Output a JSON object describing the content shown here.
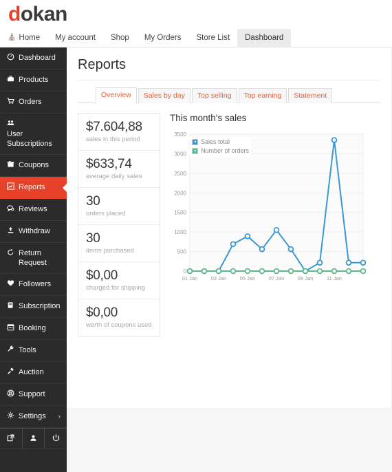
{
  "header": {
    "logo_first": "d",
    "logo_rest": "okan"
  },
  "top_nav": {
    "home_icon": "home-icon",
    "items": [
      {
        "label": "Home",
        "active": false,
        "icon": "home-icon"
      },
      {
        "label": "My account",
        "active": false
      },
      {
        "label": "Shop",
        "active": false
      },
      {
        "label": "My Orders",
        "active": false
      },
      {
        "label": "Store List",
        "active": false
      },
      {
        "label": "Dashboard",
        "active": true
      }
    ]
  },
  "sidebar": {
    "active_color": "#e8412a",
    "items": [
      {
        "label": "Dashboard",
        "icon": "dashboard-icon",
        "glyph": "⛭"
      },
      {
        "label": "Products",
        "icon": "products-icon",
        "glyph": "ὋC"
      },
      {
        "label": "Orders",
        "icon": "orders-icon",
        "glyph": "Ὥ2"
      },
      {
        "label": "User Subscriptions",
        "icon": "users-icon",
        "glyph": "὆5"
      },
      {
        "label": "Coupons",
        "icon": "coupons-icon",
        "glyph": "Ἰ1"
      },
      {
        "label": "Reports",
        "icon": "reports-icon",
        "glyph": "chart-line",
        "active": true
      },
      {
        "label": "Reviews",
        "icon": "reviews-icon",
        "glyph": "὞8"
      },
      {
        "label": "Withdraw",
        "icon": "withdraw-icon",
        "glyph": "⬆"
      },
      {
        "label": "Return Request",
        "icon": "return-icon",
        "glyph": "↺"
      },
      {
        "label": "Followers",
        "icon": "heart-icon",
        "glyph": "♥"
      },
      {
        "label": "Subscription",
        "icon": "subscription-icon",
        "glyph": "Ὅ5"
      },
      {
        "label": "Booking",
        "icon": "calendar-icon",
        "glyph": "Ὄ5"
      },
      {
        "label": "Tools",
        "icon": "wrench-icon",
        "glyph": "ὒ7"
      },
      {
        "label": "Auction",
        "icon": "gavel-icon",
        "glyph": "ὒ8"
      },
      {
        "label": "Support",
        "icon": "lifebuoy-icon",
        "glyph": "❀"
      },
      {
        "label": "Settings",
        "icon": "gear-icon",
        "glyph": "⚙",
        "chevron": "›"
      }
    ],
    "footer_buttons": [
      {
        "icon": "external-link-icon",
        "glyph": "↗"
      },
      {
        "icon": "user-icon",
        "glyph": "὆4"
      },
      {
        "icon": "power-icon",
        "glyph": "⏻"
      }
    ]
  },
  "main": {
    "title": "Reports",
    "tabs": [
      {
        "label": "Overview",
        "active": true
      },
      {
        "label": "Sales by day",
        "active": false
      },
      {
        "label": "Top selling",
        "active": false
      },
      {
        "label": "Top earning",
        "active": false
      },
      {
        "label": "Statement",
        "active": false
      }
    ],
    "stats": [
      {
        "value": "$7.604,88",
        "label": "sales in this period"
      },
      {
        "value": "$633,74",
        "label": "average daily sales"
      },
      {
        "value": "30",
        "label": "orders placed"
      },
      {
        "value": "30",
        "label": "items purchased"
      },
      {
        "value": "$0,00",
        "label": "charged for shipping"
      },
      {
        "value": "$0,00",
        "label": "worth of coupons used"
      }
    ]
  },
  "chart_data": {
    "type": "line",
    "title": "This month's sales",
    "xlabel": "",
    "ylabel": "",
    "ylim": [
      0,
      3500
    ],
    "yticks": [
      0,
      500,
      1000,
      1500,
      2000,
      2500,
      3000,
      3500
    ],
    "grid": true,
    "legend_position": "top-left",
    "x": [
      "01 Jan",
      "02 Jan",
      "03 Jan",
      "04 Jan",
      "05 Jan",
      "06 Jan",
      "07 Jan",
      "08 Jan",
      "09 Jan",
      "10 Jan",
      "11 Jan",
      "12 Jan",
      "13 Jan"
    ],
    "xtick_labels": [
      "01 Jan",
      "",
      "03 Jan",
      "",
      "05 Jan",
      "",
      "07 Jan",
      "",
      "09 Jan",
      "",
      "11 Jan",
      "",
      ""
    ],
    "series": [
      {
        "name": "Sales total",
        "color": "#3a97d4",
        "values": [
          0,
          0,
          0,
          690,
          890,
          560,
          1050,
          560,
          0,
          215,
          3350,
          215,
          215
        ]
      },
      {
        "name": "Number of orders",
        "color": "#5cb98b",
        "values": [
          0,
          0,
          0,
          0,
          0,
          0,
          0,
          0,
          0,
          0,
          0,
          0,
          0
        ]
      }
    ]
  }
}
